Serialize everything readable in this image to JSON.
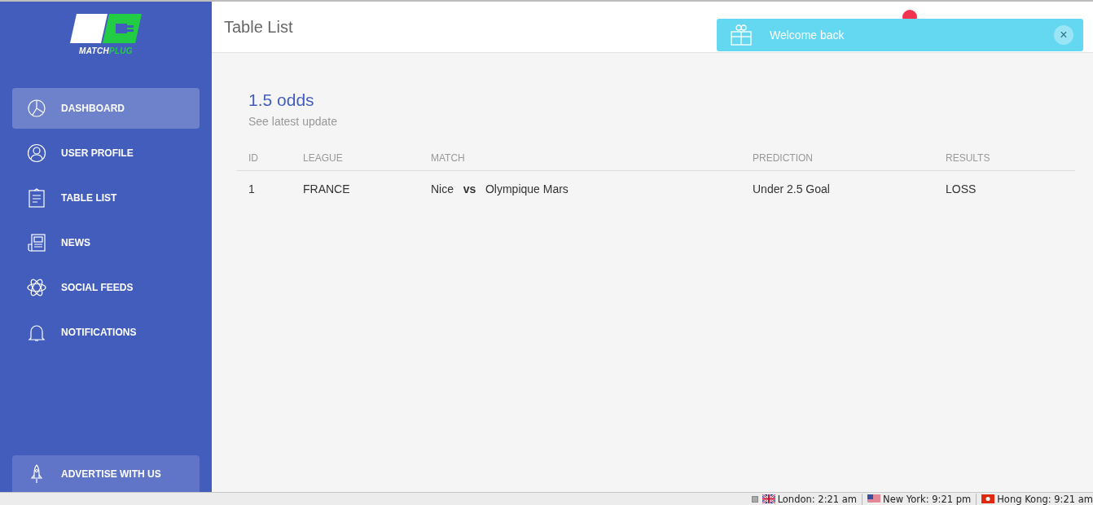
{
  "logo": {
    "prefix": "MATCH",
    "suffix": "PLUG"
  },
  "sidebar": {
    "items": [
      {
        "label": "DASHBOARD",
        "selected": true
      },
      {
        "label": "USER PROFILE",
        "selected": false
      },
      {
        "label": "TABLE LIST",
        "selected": false
      },
      {
        "label": "NEWS",
        "selected": false
      },
      {
        "label": "SOCIAL FEEDS",
        "selected": false
      },
      {
        "label": "NOTIFICATIONS",
        "selected": false
      }
    ],
    "advertise_button": "ADVERTISE WITH US"
  },
  "header": {
    "title": "Table List"
  },
  "toast": {
    "message": "Welcome back",
    "close": "×"
  },
  "card": {
    "title": "1.5 odds",
    "subtitle": "See latest update"
  },
  "table": {
    "columns": [
      "ID",
      "LEAGUE",
      "MATCH",
      "PREDICTION",
      "RESULTS"
    ],
    "rows": [
      [
        "1",
        "FRANCE",
        "Nice   **vs**   Olympique Mars",
        "Under 2.5 Goal",
        "LOSS"
      ]
    ]
  },
  "status_bar": {
    "clocks": [
      {
        "kind": "uk",
        "text": "London: 2:21 am"
      },
      {
        "kind": "us",
        "text": "New York: 9:21 pm"
      },
      {
        "kind": "hk",
        "text": "Hong Kong: 9:21 am"
      }
    ]
  }
}
